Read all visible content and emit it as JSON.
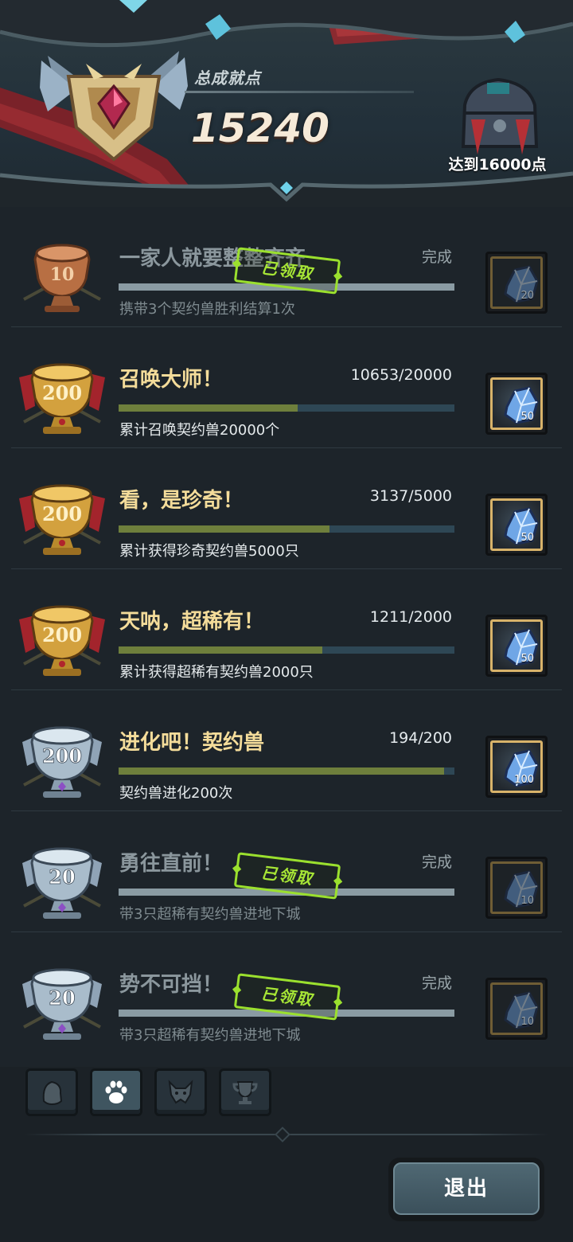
{
  "header": {
    "total_label": "总成就点",
    "total_value": "15240",
    "chest_goal": "达到16000点"
  },
  "achievements": [
    {
      "badge": "10",
      "tier": "bronze",
      "title": "一家人就要整整齐齐",
      "progress_text": "完成",
      "progress": 1.0,
      "description": "携带3个契约兽胜利结算1次",
      "reward_count": "20",
      "claimed": true,
      "stamp": "已领取"
    },
    {
      "badge": "200",
      "tier": "gold",
      "title": "召唤大师！",
      "progress_text": "10653/20000",
      "progress": 0.533,
      "description": "累计召唤契约兽20000个",
      "reward_count": "50",
      "claimed": false
    },
    {
      "badge": "200",
      "tier": "gold",
      "title": "看，是珍奇！",
      "progress_text": "3137/5000",
      "progress": 0.627,
      "description": "累计获得珍奇契约兽5000只",
      "reward_count": "50",
      "claimed": false
    },
    {
      "badge": "200",
      "tier": "gold",
      "title": "天呐，超稀有！",
      "progress_text": "1211/2000",
      "progress": 0.606,
      "description": "累计获得超稀有契约兽2000只",
      "reward_count": "50",
      "claimed": false
    },
    {
      "badge": "200",
      "tier": "silver",
      "title": "进化吧！契约兽",
      "progress_text": "194/200",
      "progress": 0.97,
      "description": "契约兽进化200次",
      "reward_count": "100",
      "claimed": false
    },
    {
      "badge": "20",
      "tier": "silver",
      "title": "勇往直前！",
      "progress_text": "完成",
      "progress": 1.0,
      "description": "带3只超稀有契约兽进地下城",
      "reward_count": "10",
      "claimed": true,
      "stamp": "已领取"
    },
    {
      "badge": "20",
      "tier": "silver",
      "title": "势不可挡！",
      "progress_text": "完成",
      "progress": 1.0,
      "description": "带3只超稀有契约兽进地下城",
      "reward_count": "10",
      "claimed": true,
      "stamp": "已领取"
    }
  ],
  "tabs": [
    {
      "icon": "character-head-icon",
      "active": false
    },
    {
      "icon": "paw-icon",
      "active": true
    },
    {
      "icon": "demon-mask-icon",
      "active": false
    },
    {
      "icon": "trophy-icon",
      "active": false
    }
  ],
  "exit_label": "退出",
  "colors": {
    "gold_title": "#f4dc9a",
    "progress_fill": "#6e7f3c",
    "stamp_green": "#9be02e",
    "reward_frame_gold": "#d8b36a"
  }
}
